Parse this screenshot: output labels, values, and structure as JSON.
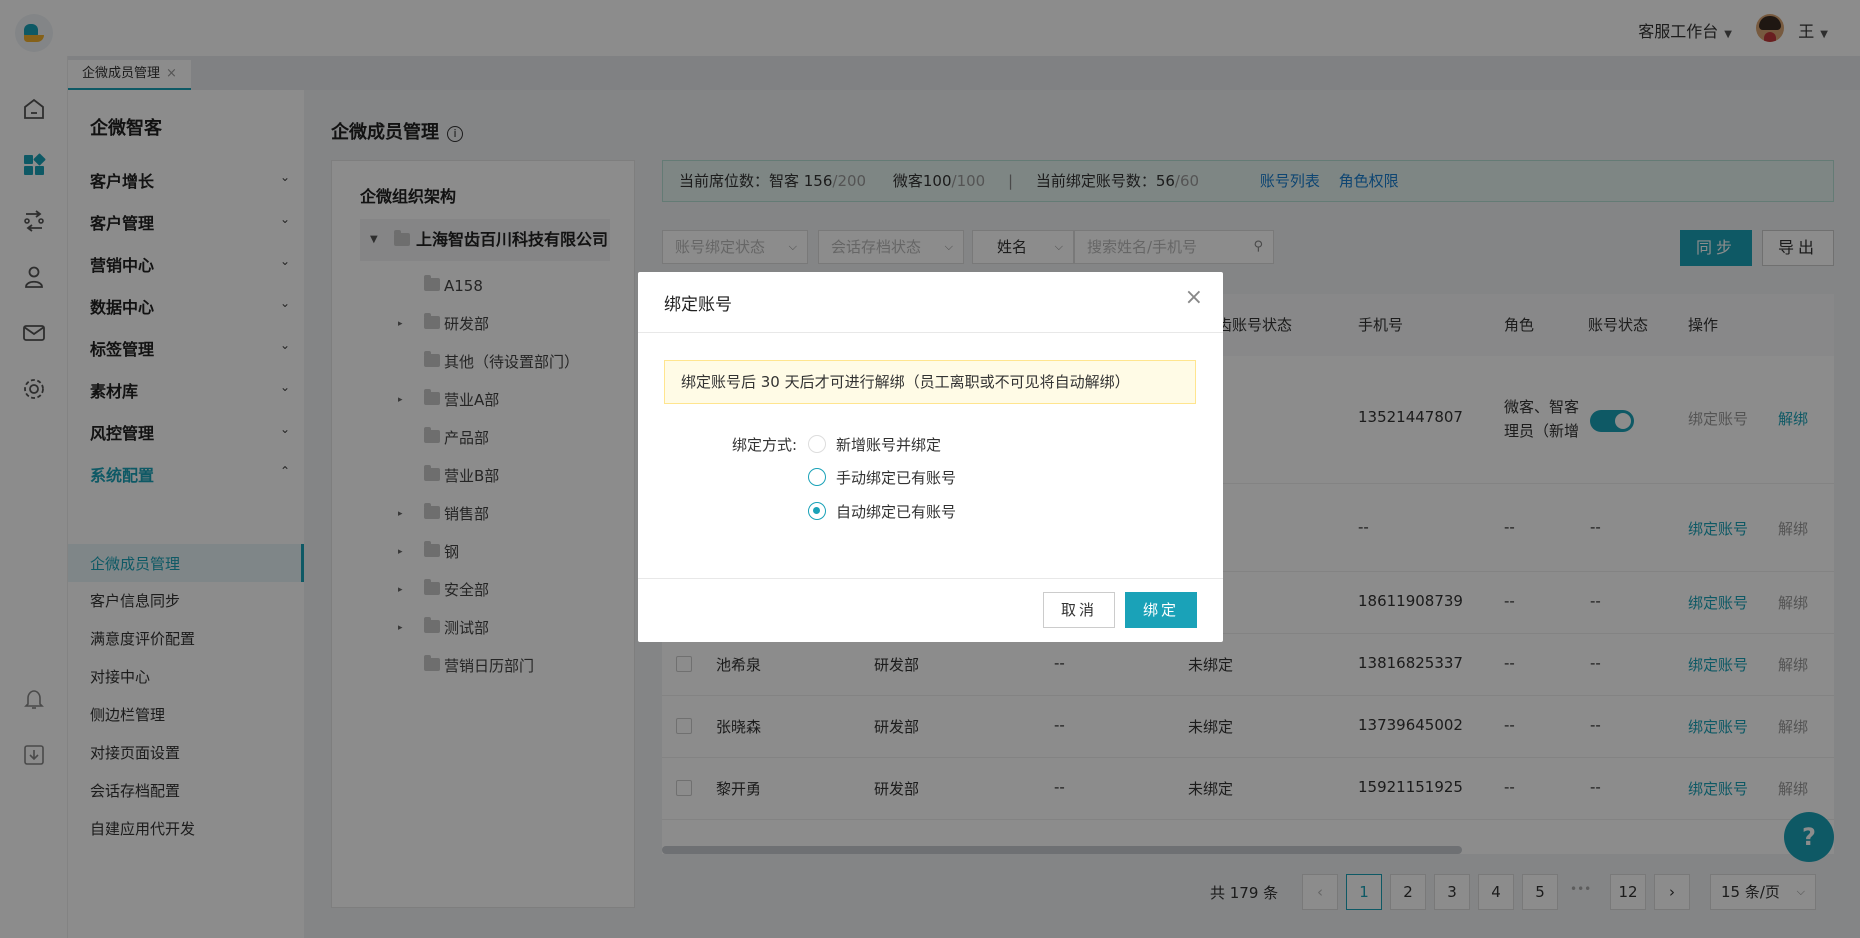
{
  "header": {
    "workspace": "客服工作台",
    "user_name": "王"
  },
  "tabs": [
    {
      "label": "企微成员管理",
      "close": "×"
    }
  ],
  "rail_icons": [
    "home-icon",
    "apps-icon",
    "flow-icon",
    "user-shield-icon",
    "mail-icon",
    "settings-icon",
    "bell-icon",
    "download-icon"
  ],
  "menu": {
    "title": "企微智客",
    "groups": [
      {
        "label": "客户增长",
        "chev": "⌄"
      },
      {
        "label": "客户管理",
        "chev": "⌄"
      },
      {
        "label": "营销中心",
        "chev": "⌄"
      },
      {
        "label": "数据中心",
        "chev": "⌄"
      },
      {
        "label": "标签管理",
        "chev": "⌄"
      },
      {
        "label": "素材库",
        "chev": "⌄"
      },
      {
        "label": "风控管理",
        "chev": "⌄"
      },
      {
        "label": "系统配置",
        "chev": "⌃"
      }
    ],
    "items": [
      "企微成员管理",
      "客户信息同步",
      "满意度评价配置",
      "对接中心",
      "侧边栏管理",
      "对接页面设置",
      "会话存档配置",
      "自建应用代开发"
    ]
  },
  "page": {
    "title": "企微成员管理",
    "info": "i"
  },
  "org": {
    "title": "企微组织架构",
    "root": "上海智齿百川科技有限公司",
    "depts": [
      {
        "name": "A158",
        "arrow": ""
      },
      {
        "name": "研发部",
        "arrow": "▸"
      },
      {
        "name": "其他（待设置部门）",
        "arrow": ""
      },
      {
        "name": "营业A部",
        "arrow": "▸"
      },
      {
        "name": "产品部",
        "arrow": ""
      },
      {
        "name": "营业B部",
        "arrow": ""
      },
      {
        "name": "销售部",
        "arrow": "▸"
      },
      {
        "name": "钢",
        "arrow": "▸"
      },
      {
        "name": "安全部",
        "arrow": "▸"
      },
      {
        "name": "测试部",
        "arrow": "▸"
      },
      {
        "name": "营销日历部门",
        "arrow": ""
      }
    ]
  },
  "notice": {
    "seat_label": "当前席位数：智客 156",
    "seat_total": "/200",
    "wk_label": "微客100",
    "wk_total": "/100",
    "sep": "|",
    "bind_label": "当前绑定账号数：56",
    "bind_total": "/60",
    "link_accounts": "账号列表",
    "link_roles": "角色权限"
  },
  "filters": {
    "bind_status": "账号绑定状态",
    "archive_status": "会话存档状态",
    "field_select": "姓名",
    "search_placeholder": "搜索姓名/手机号",
    "sync": "同步",
    "export": "导出"
  },
  "table": {
    "headers": {
      "zc_status": "智齿账号状态",
      "phone": "手机号",
      "role": "角色",
      "acct_status": "账号状态",
      "ops": "操作"
    },
    "rows": [
      {
        "name": "",
        "dept": "",
        "archive": "",
        "zc_status": "定",
        "phone": "13521447807",
        "role_line1": "微客、智客",
        "role_line2": "理员（新增",
        "status": "",
        "op_bind": "绑定账号",
        "op_unbind": "解绑"
      },
      {
        "name": "",
        "dept": "",
        "archive": "",
        "zc_status": "定",
        "phone": "--",
        "role_line1": "--",
        "role_line2": "",
        "status": "--",
        "op_bind": "绑定账号",
        "op_unbind": "解绑"
      },
      {
        "name": "",
        "dept": "",
        "archive": "",
        "zc_status": "定",
        "phone": "18611908739",
        "role_line1": "--",
        "role_line2": "",
        "status": "--",
        "op_bind": "绑定账号",
        "op_unbind": "解绑"
      },
      {
        "name": "池希泉",
        "dept": "研发部",
        "archive": "--",
        "zc_status": "未绑定",
        "phone": "13816825337",
        "role_line1": "--",
        "role_line2": "",
        "status": "--",
        "op_bind": "绑定账号",
        "op_unbind": "解绑"
      },
      {
        "name": "张晓森",
        "dept": "研发部",
        "archive": "--",
        "zc_status": "未绑定",
        "phone": "13739645002",
        "role_line1": "--",
        "role_line2": "",
        "status": "--",
        "op_bind": "绑定账号",
        "op_unbind": "解绑"
      },
      {
        "name": "黎开勇",
        "dept": "研发部",
        "archive": "--",
        "zc_status": "未绑定",
        "phone": "15921151925",
        "role_line1": "--",
        "role_line2": "",
        "status": "--",
        "op_bind": "绑定账号",
        "op_unbind": "解绑"
      }
    ]
  },
  "pagination": {
    "total": "共 179 条",
    "prev": "‹",
    "pages": [
      "1",
      "2",
      "3",
      "4",
      "5"
    ],
    "ellipsis": "•••",
    "last": "12",
    "next": "›",
    "page_size": "15 条/页",
    "current": "1"
  },
  "help": "?",
  "modal": {
    "title": "绑定账号",
    "close": "×",
    "warning": "绑定账号后 30 天后才可进行解绑（员工离职或不可见将自动解绑）",
    "method_label": "绑定方式:",
    "options": [
      {
        "label": "新增账号并绑定",
        "selected": false,
        "disabled": true
      },
      {
        "label": "手动绑定已有账号",
        "selected": false,
        "disabled": false
      },
      {
        "label": "自动绑定已有账号",
        "selected": true,
        "disabled": false
      }
    ],
    "cancel": "取消",
    "confirm": "绑定"
  },
  "colors": {
    "accent": "#1aa2b8",
    "link_blue": "#1a7fd0",
    "warning_bg": "#fffbe6"
  }
}
